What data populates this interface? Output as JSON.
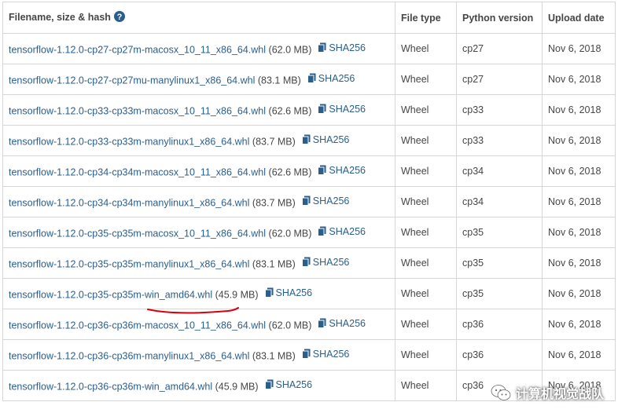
{
  "table": {
    "headers": {
      "filename": "Filename, size & hash",
      "filetype": "File type",
      "python_version": "Python version",
      "upload_date": "Upload date"
    },
    "rows": [
      {
        "filename": "tensorflow-1.12.0-cp27-cp27m-macosx_10_11_x86_64.whl",
        "size": "(62.0 MB)",
        "hash_label": "SHA256",
        "file_type": "Wheel",
        "python": "cp27",
        "date": "Nov 6, 2018"
      },
      {
        "filename": "tensorflow-1.12.0-cp27-cp27mu-manylinux1_x86_64.whl",
        "size": "(83.1 MB)",
        "hash_label": "SHA256",
        "file_type": "Wheel",
        "python": "cp27",
        "date": "Nov 6, 2018"
      },
      {
        "filename": "tensorflow-1.12.0-cp33-cp33m-macosx_10_11_x86_64.whl",
        "size": "(62.6 MB)",
        "hash_label": "SHA256",
        "file_type": "Wheel",
        "python": "cp33",
        "date": "Nov 6, 2018"
      },
      {
        "filename": "tensorflow-1.12.0-cp33-cp33m-manylinux1_x86_64.whl",
        "size": "(83.7 MB)",
        "hash_label": "SHA256",
        "file_type": "Wheel",
        "python": "cp33",
        "date": "Nov 6, 2018"
      },
      {
        "filename": "tensorflow-1.12.0-cp34-cp34m-macosx_10_11_x86_64.whl",
        "size": "(62.6 MB)",
        "hash_label": "SHA256",
        "file_type": "Wheel",
        "python": "cp34",
        "date": "Nov 6, 2018"
      },
      {
        "filename": "tensorflow-1.12.0-cp34-cp34m-manylinux1_x86_64.whl",
        "size": "(83.7 MB)",
        "hash_label": "SHA256",
        "file_type": "Wheel",
        "python": "cp34",
        "date": "Nov 6, 2018"
      },
      {
        "filename": "tensorflow-1.12.0-cp35-cp35m-macosx_10_11_x86_64.whl",
        "size": "(62.0 MB)",
        "hash_label": "SHA256",
        "file_type": "Wheel",
        "python": "cp35",
        "date": "Nov 6, 2018"
      },
      {
        "filename": "tensorflow-1.12.0-cp35-cp35m-manylinux1_x86_64.whl",
        "size": "(83.1 MB)",
        "hash_label": "SHA256",
        "file_type": "Wheel",
        "python": "cp35",
        "date": "Nov 6, 2018"
      },
      {
        "filename": "tensorflow-1.12.0-cp35-cp35m-win_amd64.whl",
        "size": "(45.9 MB)",
        "hash_label": "SHA256",
        "file_type": "Wheel",
        "python": "cp35",
        "date": "Nov 6, 2018",
        "highlighted": true
      },
      {
        "filename": "tensorflow-1.12.0-cp36-cp36m-macosx_10_11_x86_64.whl",
        "size": "(62.0 MB)",
        "hash_label": "SHA256",
        "file_type": "Wheel",
        "python": "cp36",
        "date": "Nov 6, 2018"
      },
      {
        "filename": "tensorflow-1.12.0-cp36-cp36m-manylinux1_x86_64.whl",
        "size": "(83.1 MB)",
        "hash_label": "SHA256",
        "file_type": "Wheel",
        "python": "cp36",
        "date": "Nov 6, 2018"
      },
      {
        "filename": "tensorflow-1.12.0-cp36-cp36m-win_amd64.whl",
        "size": "(45.9 MB)",
        "hash_label": "SHA256",
        "file_type": "Wheel",
        "python": "cp36",
        "date": "Nov 6, 2018"
      }
    ]
  },
  "icons": {
    "help": "question-circle-icon",
    "hash": "clipboard-icon",
    "watermark": "wechat-icon"
  },
  "watermark": {
    "text": "计算机视觉战队"
  },
  "colors": {
    "link": "#2a5e8c",
    "text": "#464646",
    "border": "#d6d6d6",
    "help_icon": "#2a5e8c",
    "underline": "#d9000d"
  }
}
